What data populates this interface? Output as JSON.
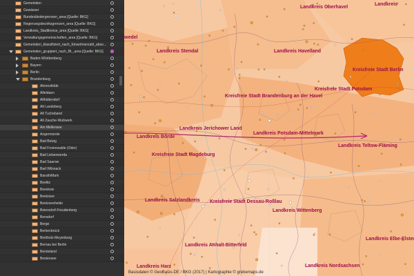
{
  "layers": [
    {
      "label": "Gemeinden",
      "indent": 22,
      "kind": "thumb",
      "twisty": "none",
      "visible": "off"
    },
    {
      "label": "Gewässer",
      "indent": 22,
      "kind": "thumb",
      "twisty": "none",
      "visible": "off"
    },
    {
      "label": "Bundesländergrenzen_area [Quelle: BKG]",
      "indent": 22,
      "kind": "thumb",
      "twisty": "none",
      "visible": "off"
    },
    {
      "label": "Regierungsbezirksgrenzen_area [Quelle: BKG]",
      "indent": 22,
      "kind": "thumb",
      "twisty": "none",
      "visible": "off"
    },
    {
      "label": "Landkreis_Stadtkreise_area [Quelle: BKG]",
      "indent": 22,
      "kind": "thumb",
      "twisty": "none",
      "visible": "off"
    },
    {
      "label": "Verwaltungsgemeinschaften_area [Quelle: BKG]",
      "indent": 22,
      "kind": "thumb",
      "twisty": "none",
      "visible": "off"
    },
    {
      "label": "Gemeinden_klassifiziert_nach_Einwohnerzahl_abso...",
      "indent": 22,
      "kind": "thumb",
      "twisty": "none",
      "visible": "off"
    },
    {
      "label": "Gemeinden_gruppiert_nach_BL_area [Quelle: BKG]",
      "indent": 22,
      "kind": "thumb",
      "twisty": "down",
      "visible": "on"
    },
    {
      "label": "Baden-Württemberg",
      "indent": 32,
      "kind": "folder",
      "twisty": "right",
      "visible": "off"
    },
    {
      "label": "Bayern",
      "indent": 32,
      "kind": "folder",
      "twisty": "right",
      "visible": "off"
    },
    {
      "label": "Berlin",
      "indent": 32,
      "kind": "folder",
      "twisty": "right",
      "visible": "off"
    },
    {
      "label": "Brandenburg",
      "indent": 32,
      "kind": "folder",
      "twisty": "down",
      "visible": "off"
    },
    {
      "label": "Ahrensfelde",
      "indent": 46,
      "kind": "thumb",
      "twisty": "none",
      "visible": "off"
    },
    {
      "label": "Alfeldaen",
      "indent": 46,
      "kind": "thumb",
      "twisty": "none",
      "visible": "off"
    },
    {
      "label": "Althüttendorf",
      "indent": 46,
      "kind": "thumb",
      "twisty": "none",
      "visible": "off"
    },
    {
      "label": "Alt Landsberg",
      "indent": 46,
      "kind": "thumb",
      "twisty": "none",
      "visible": "off"
    },
    {
      "label": "Alt Tucheband",
      "indent": 46,
      "kind": "thumb",
      "twisty": "none",
      "visible": "off"
    },
    {
      "label": "Alt Zauche-Wußwerk",
      "indent": 46,
      "kind": "thumb",
      "twisty": "none",
      "visible": "off"
    },
    {
      "label": "Am Mellensee",
      "indent": 46,
      "kind": "thumb",
      "twisty": "none",
      "visible": "off",
      "selected": true
    },
    {
      "label": "Angermünde",
      "indent": 46,
      "kind": "thumb",
      "twisty": "none",
      "visible": "off"
    },
    {
      "label": "Bad Belzig",
      "indent": 46,
      "kind": "thumb",
      "twisty": "none",
      "visible": "off"
    },
    {
      "label": "Bad Freienwalde (Oder)",
      "indent": 46,
      "kind": "thumb",
      "twisty": "none",
      "visible": "off"
    },
    {
      "label": "Bad Liebenwerda",
      "indent": 46,
      "kind": "thumb",
      "twisty": "none",
      "visible": "off"
    },
    {
      "label": "Bad Saarow",
      "indent": 46,
      "kind": "thumb",
      "twisty": "none",
      "visible": "off"
    },
    {
      "label": "Bad Wilsnack",
      "indent": 46,
      "kind": "thumb",
      "twisty": "none",
      "visible": "off"
    },
    {
      "label": "Baruth/Mark",
      "indent": 46,
      "kind": "thumb",
      "twisty": "none",
      "visible": "off"
    },
    {
      "label": "Beelitz",
      "indent": 46,
      "kind": "thumb",
      "twisty": "none",
      "visible": "off"
    },
    {
      "label": "Beeskow",
      "indent": 46,
      "kind": "thumb",
      "twisty": "none",
      "visible": "off"
    },
    {
      "label": "Beetzsee",
      "indent": 46,
      "kind": "thumb",
      "twisty": "none",
      "visible": "off"
    },
    {
      "label": "Beetzseeheide",
      "indent": 46,
      "kind": "thumb",
      "twisty": "none",
      "visible": "off"
    },
    {
      "label": "Beiersdorf-Freudenberg",
      "indent": 46,
      "kind": "thumb",
      "twisty": "none",
      "visible": "off"
    },
    {
      "label": "Bensdorf",
      "indent": 46,
      "kind": "thumb",
      "twisty": "none",
      "visible": "off"
    },
    {
      "label": "Berge",
      "indent": 46,
      "kind": "thumb",
      "twisty": "none",
      "visible": "off"
    },
    {
      "label": "Berkenbrück",
      "indent": 46,
      "kind": "thumb",
      "twisty": "none",
      "visible": "off"
    },
    {
      "label": "Berkholz-Meyenburg",
      "indent": 46,
      "kind": "thumb",
      "twisty": "none",
      "visible": "off"
    },
    {
      "label": "Bernau bei Berlin",
      "indent": 46,
      "kind": "thumb",
      "twisty": "none",
      "visible": "off"
    },
    {
      "label": "Bersteland",
      "indent": 46,
      "kind": "thumb",
      "twisty": "none",
      "visible": "off"
    },
    {
      "label": "Bestensee",
      "indent": 46,
      "kind": "thumb",
      "twisty": "none",
      "visible": "off"
    }
  ],
  "map": {
    "labels": [
      {
        "text": "Landkreis Oberhavel"
      },
      {
        "text": "Landkreis Havelland"
      },
      {
        "text": "Kreisfreie Stadt Berlin"
      },
      {
        "text": "Landkreis Stendal"
      },
      {
        "text": "Kreisfreie Stadt Potsdam"
      },
      {
        "text": "Kreisfreie Stadt Brandenburg an der Havel"
      },
      {
        "text": "Landkreis Jerichower Land"
      },
      {
        "text": "Landkreis Potsdam-Mittelmark"
      },
      {
        "text": "Landkreis Teltow-Fläming"
      },
      {
        "text": "Landkreis Börde"
      },
      {
        "text": "Kreisfreie Stadt Magdeburg"
      },
      {
        "text": "Landkreis Salzlandkreis"
      },
      {
        "text": "Kreisfreie Stadt Dessau-Roßlau"
      },
      {
        "text": "Landkreis Wittenberg"
      },
      {
        "text": "Landkreis Elbe-Elster"
      },
      {
        "text": "Landkreis Anhalt-Bitterfeld"
      },
      {
        "text": "Landkreis Nordsachsen"
      },
      {
        "text": "Landkreis Harz"
      },
      {
        "text": "Landkreis"
      },
      {
        "text": "wedel"
      }
    ],
    "credit": "Basisdaten © GeoBasis-DE / BKG (2017) | Kartographie © grebemaps.de",
    "colors": {
      "highlight": "#ef7d1a",
      "base": "#f8c9a0",
      "light": "#fbe3cf",
      "arrow": "#b2246a",
      "label": "#9e0e4a"
    }
  }
}
